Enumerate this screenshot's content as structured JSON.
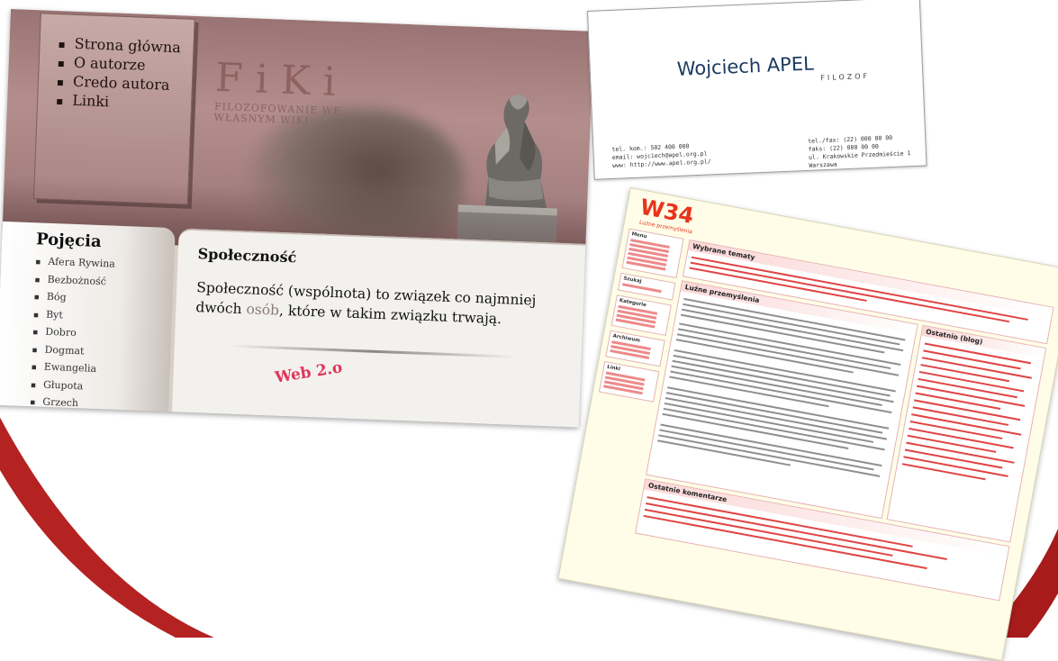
{
  "fiki": {
    "nav": [
      "Strona główna",
      "O autorze",
      "Credo autora",
      "Linki"
    ],
    "logo": "FiKi",
    "subtitle": "FILOZOFOWANIE WE WŁASNYM WIKI",
    "sidebar_title": "Pojęcia",
    "sidebar_items": [
      "Afera Rywina",
      "Bezbożność",
      "Bóg",
      "Byt",
      "Dobro",
      "Dogmat",
      "Ewangelia",
      "Głupota",
      "Grzech"
    ],
    "article_title": "Społeczność",
    "article_text_before": "Społeczność (wspólnota) to związek co najmniej dwóch ",
    "article_link": "osób",
    "article_text_after": ", które w takim związku trwają.",
    "caption": "Web 2.o"
  },
  "business_card": {
    "name": "Wojciech APEL",
    "role": "FILOZOF",
    "left_lines": [
      "tel. kom.: 502 400 000",
      "email: wojciech@apel.org.pl",
      "www: http://www.apel.org.pl/"
    ],
    "right_lines": [
      "tel./fax: (22) 000 00 00",
      "faks: (22) 000 00 00",
      "ul. Krakowskie Przedmieście 1 Warszawa"
    ]
  },
  "w34": {
    "logo": "W34",
    "tagline": "Luźne przemyślenia",
    "panel_featured": "Wybrane tematy",
    "panel_thoughts": "Luźne przemyślenia",
    "panel_blog": "Ostatnio (blog)",
    "panel_comments": "Ostatnie komentarze",
    "side_titles": [
      "Menu",
      "Szukaj",
      "Kategorie",
      "Archiwum",
      "Linki"
    ]
  },
  "colors": {
    "arc": "#b01e1e",
    "fiki_header": "#a58080",
    "w34_accent": "#e8341c"
  }
}
